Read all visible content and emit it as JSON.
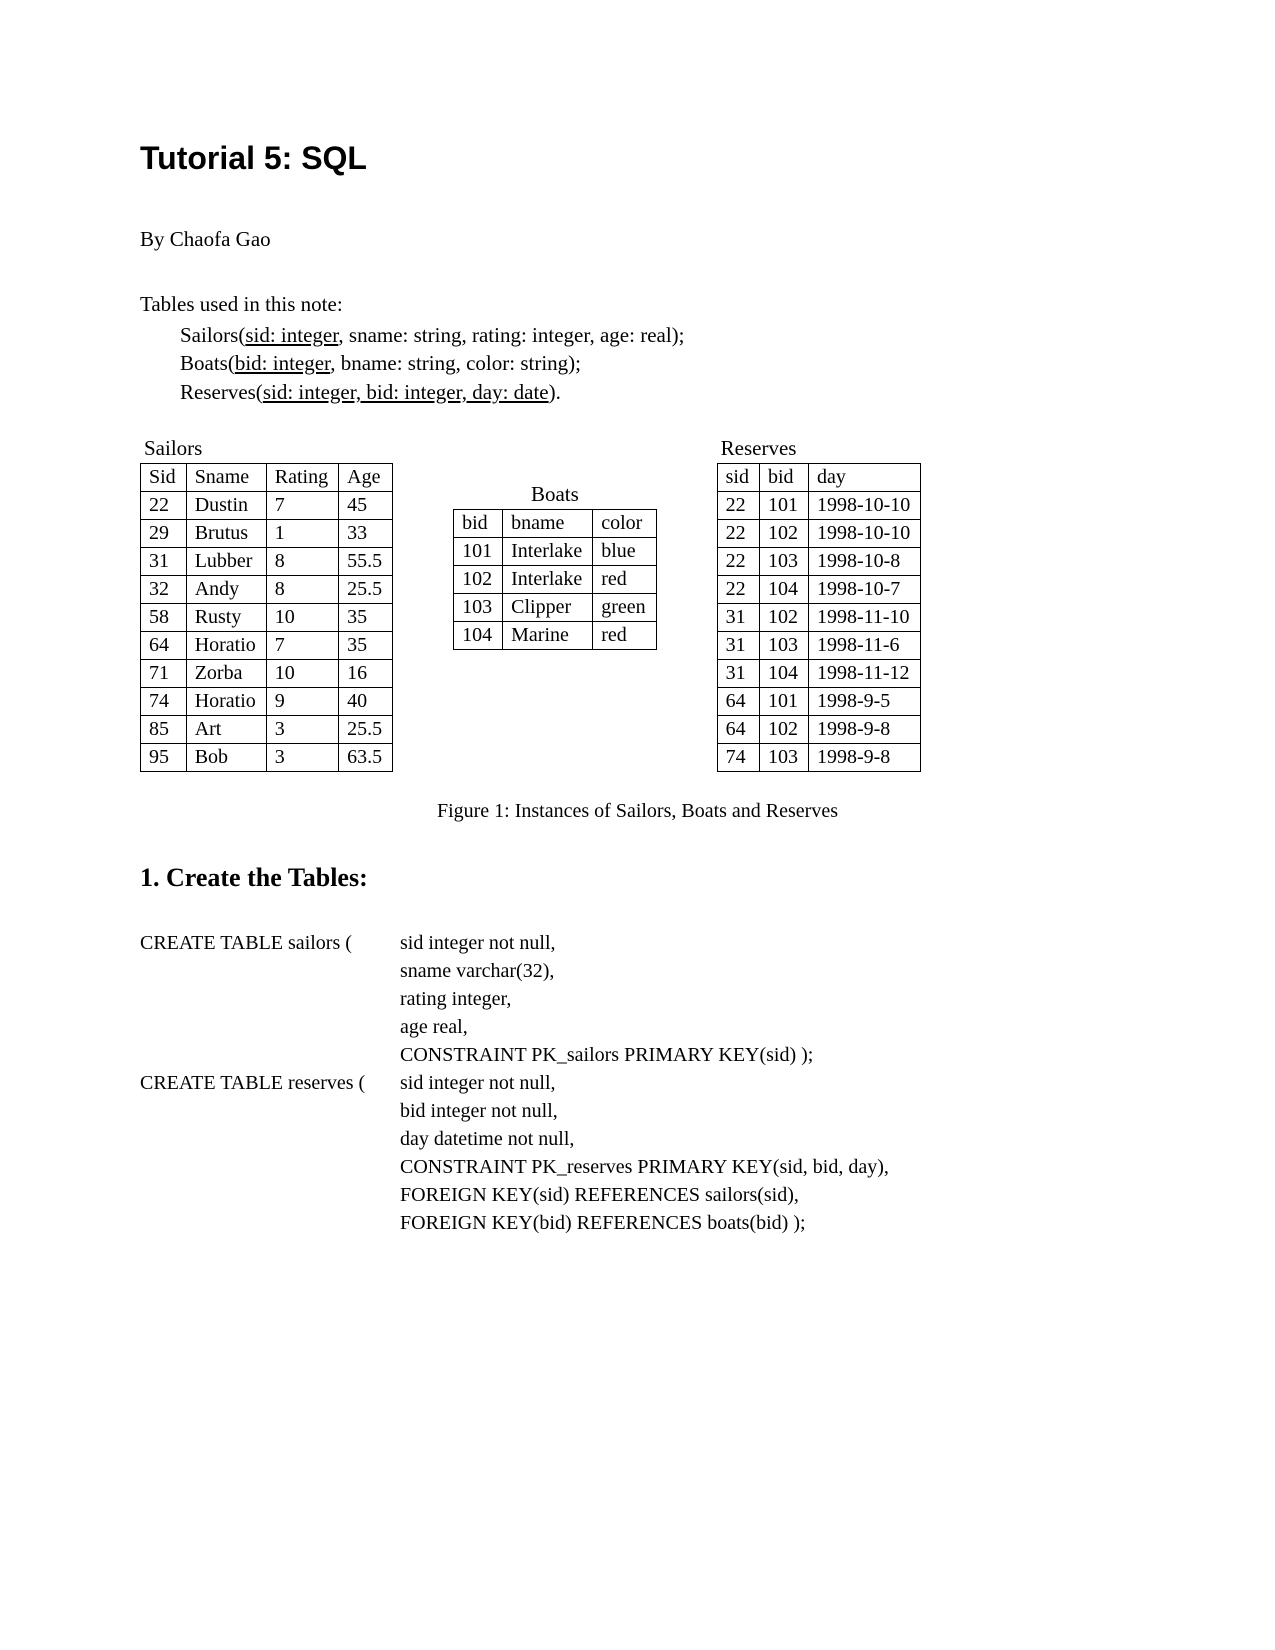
{
  "title": "Tutorial 5: SQL",
  "author": "By Chaofa Gao",
  "schema_intro": "Tables used in this note:",
  "schema": {
    "sailors": {
      "name": "Sailors(",
      "key": "sid: integer",
      "rest": ", sname: string, rating: integer, age: real);"
    },
    "boats": {
      "name": "Boats(",
      "key": "bid: integer",
      "rest": ", bname: string, color: string);"
    },
    "reserves": {
      "name": "Reserves(",
      "key": "sid: integer, bid: integer, day: date",
      "rest": ")."
    }
  },
  "sailors": {
    "title": "Sailors",
    "headers": [
      "Sid",
      "Sname",
      "Rating",
      "Age"
    ],
    "rows": [
      [
        "22",
        "Dustin",
        "7",
        "45"
      ],
      [
        "29",
        "Brutus",
        "1",
        "33"
      ],
      [
        "31",
        "Lubber",
        "8",
        "55.5"
      ],
      [
        "32",
        "Andy",
        "8",
        "25.5"
      ],
      [
        "58",
        "Rusty",
        "10",
        "35"
      ],
      [
        "64",
        "Horatio",
        "7",
        "35"
      ],
      [
        "71",
        "Zorba",
        "10",
        "16"
      ],
      [
        "74",
        "Horatio",
        "9",
        "40"
      ],
      [
        "85",
        "Art",
        "3",
        "25.5"
      ],
      [
        "95",
        "Bob",
        "3",
        "63.5"
      ]
    ]
  },
  "boats": {
    "title": "Boats",
    "headers": [
      "bid",
      "bname",
      "color"
    ],
    "rows": [
      [
        "101",
        "Interlake",
        "blue"
      ],
      [
        "102",
        "Interlake",
        "red"
      ],
      [
        "103",
        "Clipper",
        "green"
      ],
      [
        "104",
        "Marine",
        "red"
      ]
    ]
  },
  "reserves": {
    "title": "Reserves",
    "headers": [
      "sid",
      "bid",
      "day"
    ],
    "rows": [
      [
        "22",
        "101",
        "1998-10-10"
      ],
      [
        "22",
        "102",
        "1998-10-10"
      ],
      [
        "22",
        "103",
        "1998-10-8"
      ],
      [
        "22",
        "104",
        "1998-10-7"
      ],
      [
        "31",
        "102",
        "1998-11-10"
      ],
      [
        "31",
        "103",
        "1998-11-6"
      ],
      [
        "31",
        "104",
        "1998-11-12"
      ],
      [
        "64",
        "101",
        "1998-9-5"
      ],
      [
        "64",
        "102",
        "1998-9-8"
      ],
      [
        "74",
        "103",
        "1998-9-8"
      ]
    ]
  },
  "figure_caption": "Figure 1: Instances of Sailors, Boats and Reserves",
  "section1": "1. Create the Tables:",
  "sql": {
    "sailors_head": "CREATE TABLE sailors (",
    "sailors_lines": [
      "sid integer not null,",
      "sname varchar(32),",
      "rating integer,",
      "age real,",
      "CONSTRAINT PK_sailors PRIMARY KEY(sid) );"
    ],
    "reserves_head": "CREATE TABLE reserves (",
    "reserves_lines": [
      "sid integer not null,",
      "bid integer not null,",
      "day datetime not null,",
      "CONSTRAINT PK_reserves PRIMARY KEY(sid, bid, day),",
      "FOREIGN KEY(sid) REFERENCES sailors(sid),",
      "FOREIGN KEY(bid) REFERENCES boats(bid) );"
    ]
  }
}
